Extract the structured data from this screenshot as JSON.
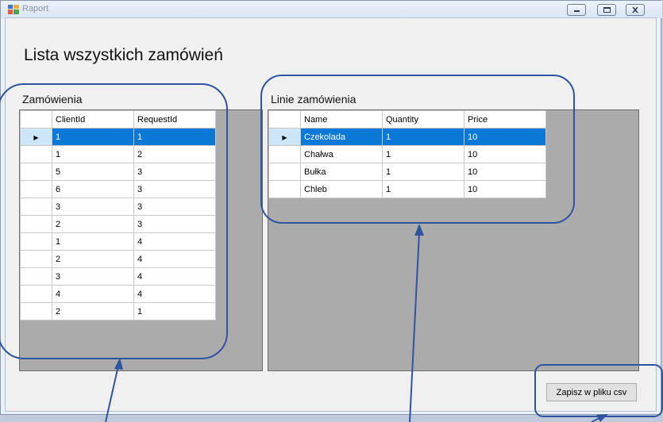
{
  "window": {
    "title": "Raport"
  },
  "page": {
    "heading": "Lista wszystkich zamówień"
  },
  "orders": {
    "label": "Zamówienia",
    "columns": [
      "ClientId",
      "RequestId"
    ],
    "rows": [
      [
        "1",
        "1"
      ],
      [
        "1",
        "2"
      ],
      [
        "5",
        "3"
      ],
      [
        "6",
        "3"
      ],
      [
        "3",
        "3"
      ],
      [
        "2",
        "3"
      ],
      [
        "1",
        "4"
      ],
      [
        "2",
        "4"
      ],
      [
        "3",
        "4"
      ],
      [
        "4",
        "4"
      ],
      [
        "2",
        "1"
      ]
    ],
    "selected_row": 0
  },
  "order_lines": {
    "label": "Linie zamówienia",
    "columns": [
      "Name",
      "Quantity",
      "Price"
    ],
    "rows": [
      [
        "Czekolada",
        "1",
        "10"
      ],
      [
        "Chałwa",
        "1",
        "10"
      ],
      [
        "Bułka",
        "1",
        "10"
      ],
      [
        "Chleb",
        "1",
        "10"
      ]
    ],
    "selected_row": 0
  },
  "actions": {
    "save_csv": "Zapisz w pliku csv"
  },
  "colors": {
    "annotation": "#2f55a0",
    "selection": "#0a78d7",
    "grid_background": "#ababab"
  }
}
